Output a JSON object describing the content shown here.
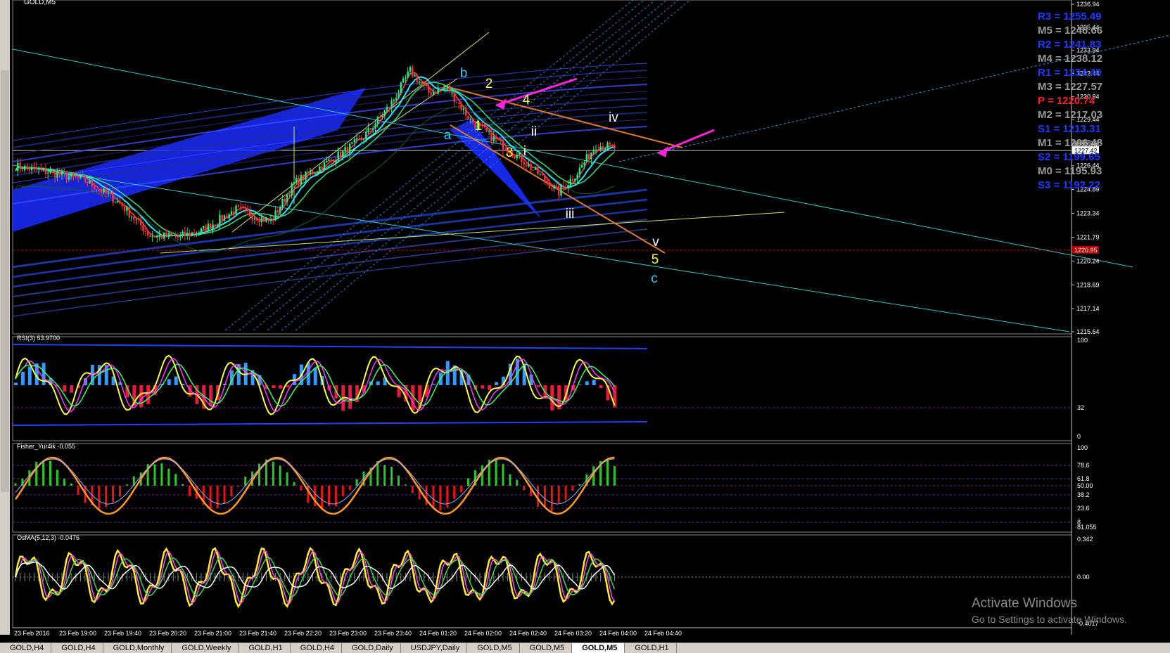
{
  "symbol": "GOLD,M5",
  "main_axis": {
    "min": 1215.64,
    "max": 1236.94,
    "ticks": [
      "1236.94",
      "1235.44",
      "1233.94",
      "1232.44",
      "1230.94",
      "1229.44",
      "1227.94",
      "1226.44",
      "1224.89",
      "1223.34",
      "1221.79",
      "1220.24",
      "1218.69",
      "1217.14",
      "1215.64"
    ],
    "price_tags": [
      {
        "label": "1227.78",
        "price": 1227.78,
        "color": "#555555"
      },
      {
        "label": "1227.42",
        "price": 1227.42,
        "color": "#ffffff"
      },
      {
        "label": "1220.95",
        "price": 1220.95,
        "color": "#c00000"
      }
    ]
  },
  "pivots": [
    {
      "label": "R3 = 1255.49",
      "color": "#1a3cff"
    },
    {
      "label": "M5 = 1248.66",
      "color": "#9a9a9a"
    },
    {
      "label": "R2 = 1241.83",
      "color": "#1a3cff"
    },
    {
      "label": "M4 = 1238.12",
      "color": "#9a9a9a"
    },
    {
      "label": "R1 = 1234.40",
      "color": "#1a3cff"
    },
    {
      "label": "M3 = 1227.57",
      "color": "#9a9a9a"
    },
    {
      "label": "P  = 1220.74",
      "color": "#ff2020"
    },
    {
      "label": "M2 = 1217.03",
      "color": "#9a9a9a"
    },
    {
      "label": "S1 = 1213.31",
      "color": "#1a3cff"
    },
    {
      "label": "M1 = 1206.48",
      "color": "#9a9a9a"
    },
    {
      "label": "S2 = 1199.65",
      "color": "#1a3cff"
    },
    {
      "label": "M0 = 1195.93",
      "color": "#9a9a9a"
    },
    {
      "label": "S3 = 1192.22",
      "color": "#1a3cff"
    }
  ],
  "wave_labels": [
    {
      "text": "b",
      "color": "#22ccff"
    },
    {
      "text": "2",
      "color": "#ffff33"
    },
    {
      "text": "1",
      "color": "#ffff33"
    },
    {
      "text": "4",
      "color": "#ffff33"
    },
    {
      "text": "a",
      "color": "#22ccff"
    },
    {
      "text": "ii",
      "color": "#ffffff"
    },
    {
      "text": "3",
      "color": "#ffff33"
    },
    {
      "text": "i",
      "color": "#ffffff"
    },
    {
      "text": "iv",
      "color": "#ffffff"
    },
    {
      "text": "iii",
      "color": "#ffffff"
    },
    {
      "text": "v",
      "color": "#ffffff"
    },
    {
      "text": "5",
      "color": "#ffff33"
    },
    {
      "text": "c",
      "color": "#22ccff"
    }
  ],
  "rsi": {
    "title": "RSI(3) 53.9700",
    "ticks": [
      "100",
      "32",
      "0"
    ]
  },
  "fisher": {
    "title": "Fisher_Yur4ik -0.055",
    "ticks": [
      "100",
      "78.6",
      "61.8",
      "50.00",
      "38.2",
      "23.6",
      "8",
      "81.055"
    ],
    "top_extra": "095"
  },
  "osma": {
    "title": "OsMA(5,12,3) -0.0476",
    "ticks": [
      "0.342",
      "0.00",
      "-0.4017"
    ]
  },
  "time_axis": [
    "23 Feb 2016",
    "23 Feb 19:00",
    "23 Feb 19:40",
    "23 Feb 20:20",
    "23 Feb 21:00",
    "23 Feb 21:40",
    "23 Feb 22:20",
    "23 Feb 23:00",
    "23 Feb 23:40",
    "24 Feb 01:20",
    "24 Feb 02:00",
    "24 Feb 02:40",
    "24 Feb 03:20",
    "24 Feb 04:00",
    "24 Feb 04:40"
  ],
  "tabs": [
    "GOLD,H4",
    "GOLD,H4",
    "GOLD,Monthly",
    "GOLD,Weekly",
    "GOLD,H1",
    "GOLD,H4",
    "GOLD,Daily",
    "USDJPY,Daily",
    "GOLD,M5",
    "GOLD,M5",
    "GOLD,M5",
    "GOLD,H1"
  ],
  "active_tab": 10,
  "watermark": {
    "title": "Activate Windows",
    "subtitle": "Go to Settings to activate Windows."
  },
  "colors": {
    "bull": "#22ee88",
    "bear": "#ff3333",
    "axis": "#c0c0c0",
    "grid_sep": "#8a8a8a",
    "hist_up": "#3399ff",
    "hist_dn": "#e8193c"
  }
}
